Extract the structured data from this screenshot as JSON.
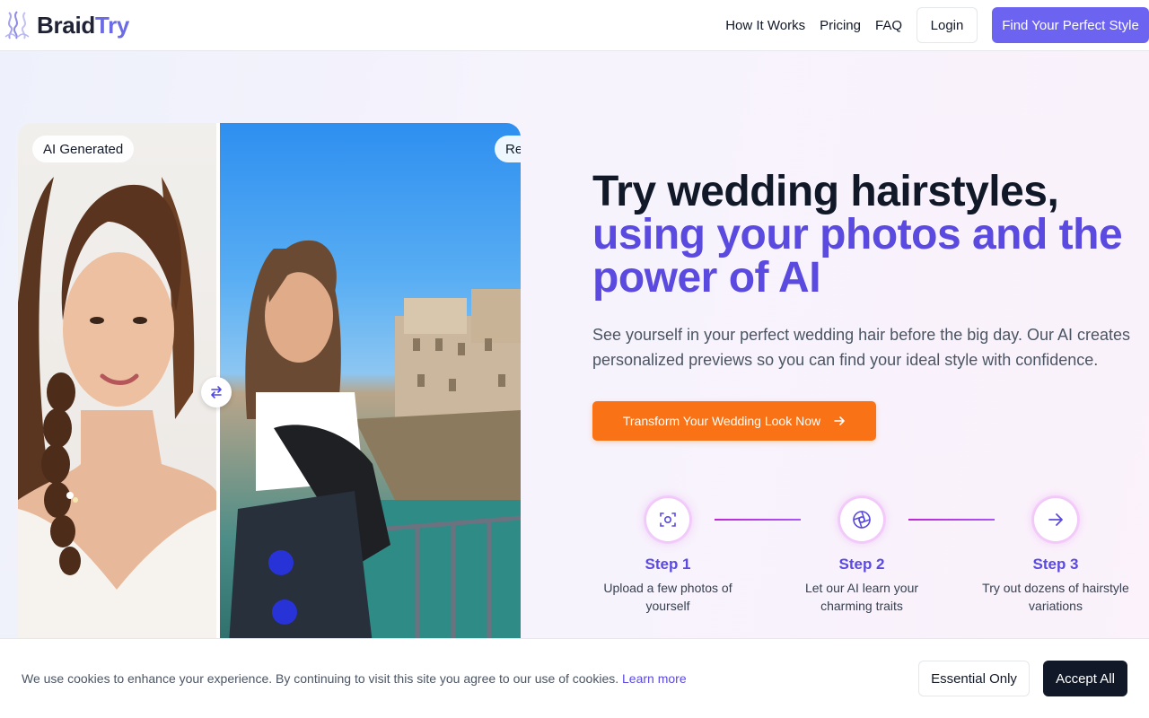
{
  "brand": {
    "part1": "Braid",
    "part2": "Try",
    "accent": "#6b6be6"
  },
  "nav": {
    "links": [
      "How It Works",
      "Pricing",
      "FAQ"
    ],
    "login_label": "Login",
    "cta_label": "Find Your Perfect Style",
    "cta_color": "#6c63f0"
  },
  "comparison": {
    "left_tag": "AI Generated",
    "right_tag": "Re",
    "handle_icon": "swap-arrows-icon"
  },
  "hero": {
    "title_line1": "Try wedding hairstyles,",
    "title_line2": "using your photos and the power of AI",
    "subtitle": "See yourself in your perfect wedding hair before the big day. Our AI creates personalized previews so you can find your ideal style with confidence.",
    "cta_label": "Transform Your Wedding Look Now",
    "cta_color": "#f97316",
    "accent": "#5a4ae0"
  },
  "steps": [
    {
      "icon": "scan-face-icon",
      "title": "Step 1",
      "desc": "Upload a few photos of yourself"
    },
    {
      "icon": "aperture-icon",
      "title": "Step 2",
      "desc": "Let our AI learn your charming traits"
    },
    {
      "icon": "arrow-right-icon",
      "title": "Step 3",
      "desc": "Try out dozens of hairstyle variations"
    }
  ],
  "cookie": {
    "text": "We use cookies to enhance your experience. By continuing to visit this site you agree to our use of cookies.",
    "link": "Learn more",
    "essential_label": "Essential Only",
    "accept_label": "Accept All"
  }
}
